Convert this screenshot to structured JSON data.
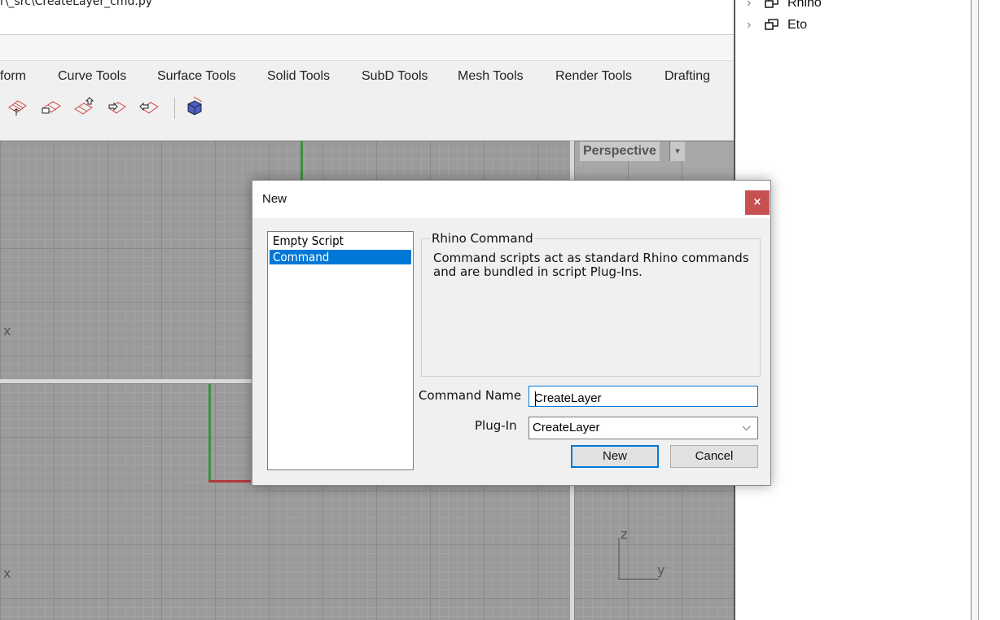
{
  "editor": {
    "file_path": "r\\_src\\CreateLayer_cmd.py"
  },
  "toolbar": {
    "tabs": [
      "form",
      "Curve Tools",
      "Surface Tools",
      "Solid Tools",
      "SubD Tools",
      "Mesh Tools",
      "Render Tools",
      "Drafting"
    ]
  },
  "viewports": {
    "perspective_label": "Perspective",
    "top_axis_x": "x",
    "front_axis_x": "x",
    "right_axis_z": "z",
    "right_axis_y": "y"
  },
  "right_panel": {
    "tree": [
      {
        "label": "Rhino"
      },
      {
        "label": "Eto"
      }
    ]
  },
  "dialog": {
    "title": "New",
    "close_glyph": "×",
    "templates": [
      "Empty Script",
      "Command"
    ],
    "selected_template": "Command",
    "group_title": "Rhino Command",
    "description": "Command scripts act as standard Rhino commands and are bundled in script Plug-Ins.",
    "command_name_label": "Command Name",
    "command_name_value": "CreateLayer",
    "plugin_label": "Plug-In",
    "plugin_value": "CreateLayer",
    "new_button": "New",
    "cancel_button": "Cancel"
  }
}
